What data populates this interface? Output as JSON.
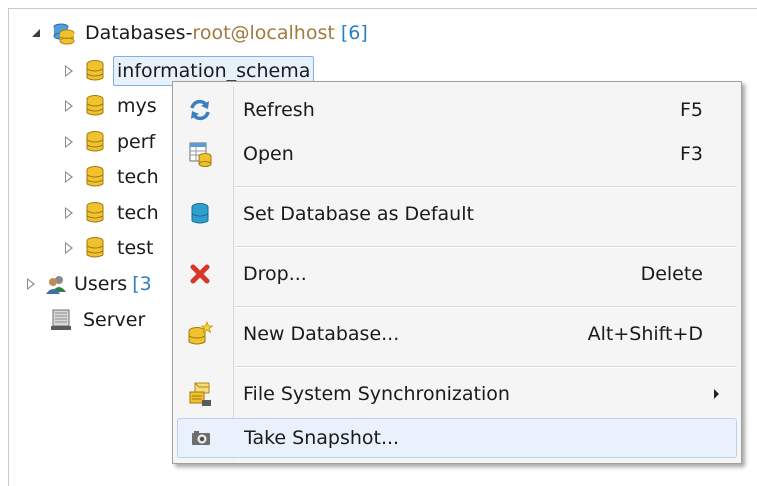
{
  "tree": {
    "root": {
      "label": "Databases",
      "separator": " - ",
      "host": "root@localhost",
      "count": "[6]"
    },
    "databases": [
      "information_schema",
      "mys",
      "perf",
      "tech",
      "tech",
      "test"
    ],
    "users": {
      "label": "Users",
      "count": "[3"
    },
    "server": {
      "label": "Server"
    }
  },
  "context_menu": {
    "items": [
      {
        "label": "Refresh",
        "shortcut": "F5",
        "icon": "refresh-icon"
      },
      {
        "label": "Open",
        "shortcut": "F3",
        "icon": "open-table-icon"
      },
      {
        "label": "Set Database as Default",
        "shortcut": "",
        "icon": "database-icon"
      },
      {
        "label": "Drop...",
        "shortcut": "Delete",
        "icon": "drop-icon"
      },
      {
        "label": "New Database...",
        "shortcut": "Alt+Shift+D",
        "icon": "new-database-icon"
      },
      {
        "label": "File System Synchronization",
        "shortcut": "",
        "icon": "sync-icon",
        "submenu": true
      },
      {
        "label": "Take Snapshot...",
        "shortcut": "",
        "icon": "camera-icon"
      }
    ]
  },
  "colors": {
    "host": "#a17a3c",
    "count": "#2f7fbf",
    "db_icon": "#e0a820",
    "drop": "#d9362b",
    "hover": "#e9f2fc"
  }
}
